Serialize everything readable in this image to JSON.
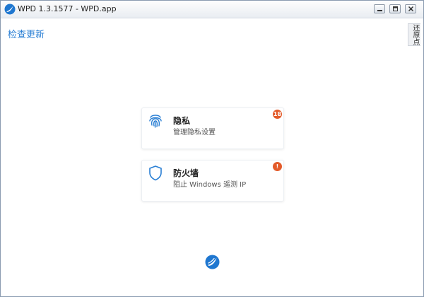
{
  "window": {
    "title": "WPD 1.3.1577 - WPD.app",
    "controls": [
      "minimize",
      "maximize",
      "close"
    ]
  },
  "header": {
    "check_update": "检查更新",
    "restore_points": "还原点"
  },
  "cards": [
    {
      "title": "隐私",
      "subtitle": "管理隐私设置",
      "badge": "18",
      "icon": "fingerprint-icon",
      "badge_color": "#e35b2a"
    },
    {
      "title": "防火墙",
      "subtitle": "阻止 Windows 遥测 IP",
      "badge": "!",
      "icon": "shield-icon",
      "badge_color": "#e35b2a"
    }
  ],
  "colors": {
    "accent": "#2a7fd4",
    "alert": "#e35b2a"
  }
}
